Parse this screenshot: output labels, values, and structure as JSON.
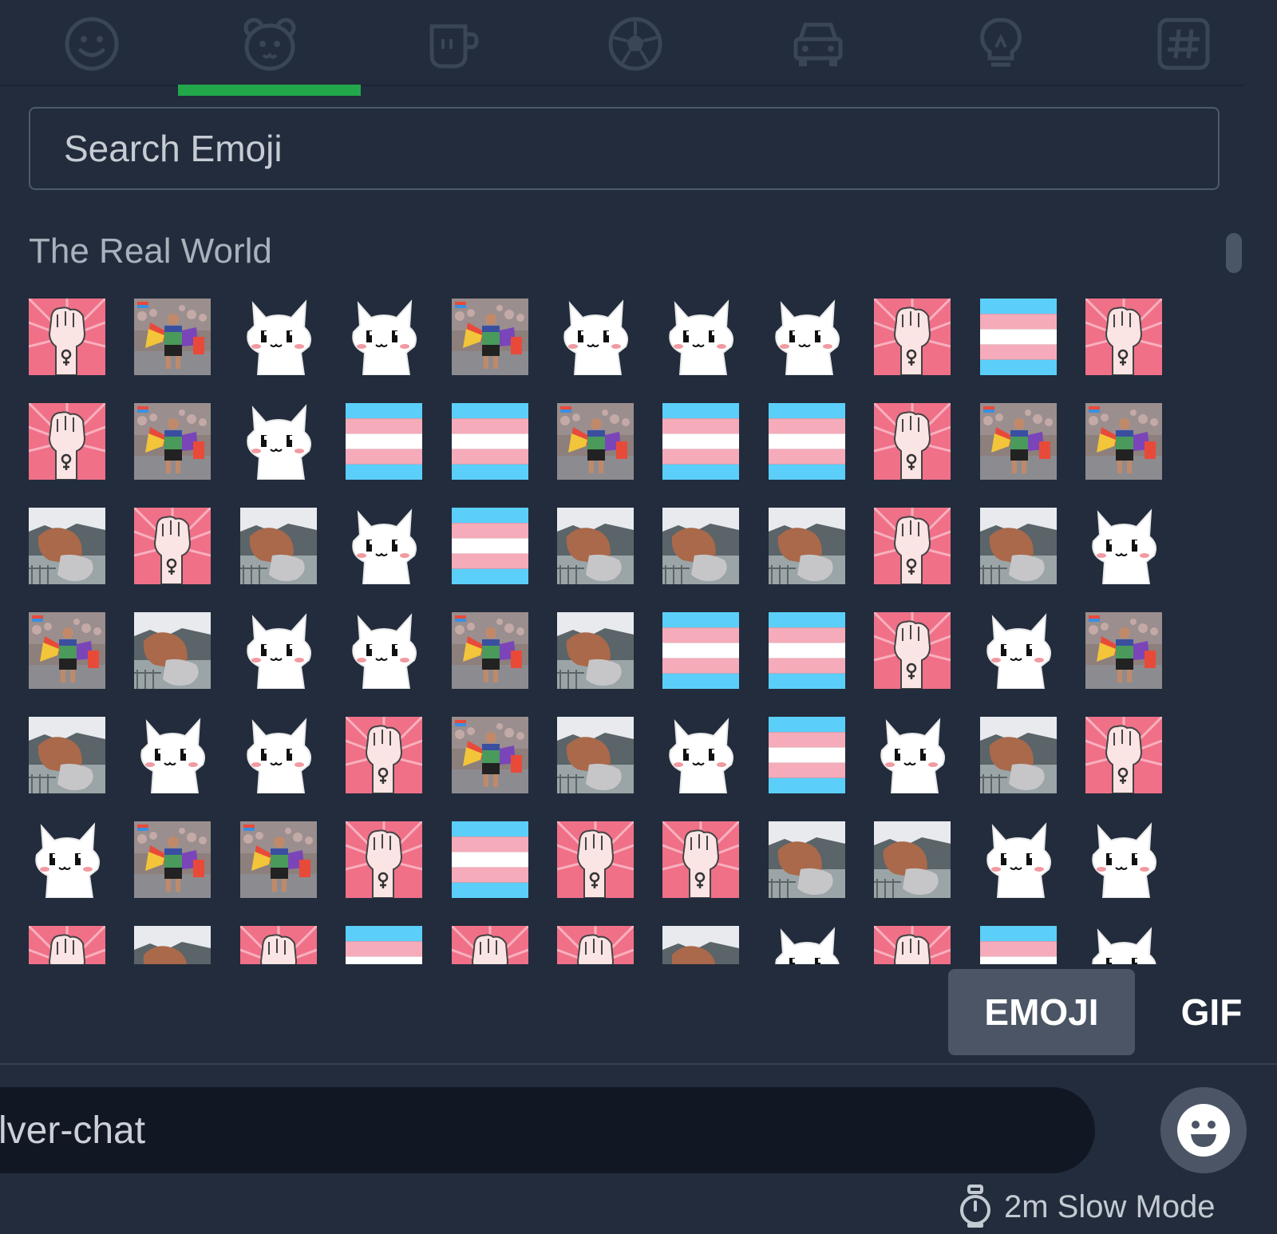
{
  "tabs": [
    {
      "name": "smileys",
      "icon": "smiley-face-icon"
    },
    {
      "name": "animals",
      "icon": "bear-face-icon",
      "active": true
    },
    {
      "name": "food",
      "icon": "coffee-cup-icon"
    },
    {
      "name": "activities",
      "icon": "soccer-ball-icon"
    },
    {
      "name": "travel",
      "icon": "car-icon"
    },
    {
      "name": "objects",
      "icon": "lightbulb-icon"
    },
    {
      "name": "symbols",
      "icon": "hashtag-icon"
    }
  ],
  "search": {
    "placeholder": "Search Emoji"
  },
  "section": {
    "title": "The Real World"
  },
  "emoji_grid": {
    "rows": [
      [
        "fist",
        "pride",
        "cat",
        "cat",
        "pride",
        "cat",
        "cat",
        "cat",
        "fist",
        "flag",
        "fist"
      ],
      [
        "fist",
        "pride",
        "cat",
        "flag",
        "flag",
        "pride",
        "flag",
        "flag",
        "fist",
        "pride",
        "pride"
      ],
      [
        "muscle",
        "fist",
        "muscle",
        "cat",
        "flag",
        "muscle",
        "muscle",
        "muscle",
        "fist",
        "muscle",
        "cat"
      ],
      [
        "pride",
        "muscle",
        "cat",
        "cat",
        "pride",
        "muscle",
        "flag",
        "flag",
        "fist",
        "cat",
        "pride"
      ],
      [
        "muscle",
        "cat",
        "cat",
        "fist",
        "pride",
        "muscle",
        "cat",
        "flag",
        "cat",
        "muscle",
        "fist"
      ],
      [
        "cat",
        "pride",
        "pride",
        "fist",
        "flag",
        "fist",
        "fist",
        "muscle",
        "muscle",
        "cat",
        "cat"
      ],
      [
        "fist",
        "muscle",
        "fist",
        "flag",
        "fist",
        "fist",
        "muscle",
        "cat",
        "fist",
        "flag",
        "cat"
      ]
    ]
  },
  "picker_tabs": {
    "emoji": "EMOJI",
    "gif": "GIF"
  },
  "composer": {
    "placeholder": "lver-chat"
  },
  "slow_mode": {
    "label": "2m Slow Mode"
  },
  "colors": {
    "accent": "#22a84a",
    "background": "#222c3c",
    "composer": "#111824"
  }
}
